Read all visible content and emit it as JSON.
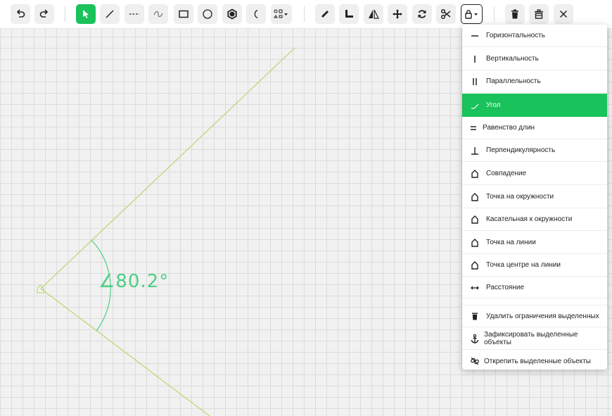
{
  "toolbar": {
    "groups": [
      [
        "undo-icon",
        "redo-icon"
      ],
      [
        "pointer-icon",
        "line-icon",
        "dashed-line-icon",
        "curve-icon",
        "rectangle-icon",
        "circle-icon",
        "polygon-icon",
        "arc-icon",
        "shapes-dropdown-icon"
      ],
      [
        "ruler-icon",
        "corner-ruler-icon",
        "mirror-icon",
        "move-icon",
        "rotate-icon",
        "scissors-icon",
        "lock-dropdown-icon"
      ],
      [
        "trash-icon",
        "trash-all-icon",
        "close-icon"
      ]
    ],
    "active_tool": "pointer-icon"
  },
  "canvas": {
    "angle_label": "∠80.2°",
    "line_color": "#c3d171",
    "arc_color": "#4ccf85"
  },
  "constraints_menu": {
    "items": [
      {
        "icon": "horizontal-icon",
        "label": "Горизонтальность"
      },
      {
        "icon": "vertical-icon",
        "label": "Вертикальность"
      },
      {
        "icon": "parallel-icon",
        "label": "Параллельность"
      },
      {
        "icon": "angle-icon",
        "label": "Угол",
        "selected": true
      },
      {
        "icon": "equal-icon",
        "label": "Равенство длин"
      },
      {
        "icon": "perpendicular-icon",
        "label": "Перпендикулярность"
      },
      {
        "icon": "point-icon",
        "label": "Совпадение"
      },
      {
        "icon": "point-icon",
        "label": "Точка на окружности"
      },
      {
        "icon": "point-icon",
        "label": "Касательная к окружности"
      },
      {
        "icon": "point-icon",
        "label": "Точка на линии"
      },
      {
        "icon": "point-icon",
        "label": "Точка центре на линии"
      },
      {
        "icon": "distance-icon",
        "label": "Расстояние"
      }
    ],
    "actions": [
      {
        "icon": "trash-icon",
        "label": "Удалить ограничения выделенных"
      },
      {
        "icon": "anchor-icon",
        "label": "Зафиксировать выделенные объекты"
      },
      {
        "icon": "unlink-icon",
        "label": "Открепить выделенные объекты"
      }
    ],
    "accent": "#19c25b"
  }
}
